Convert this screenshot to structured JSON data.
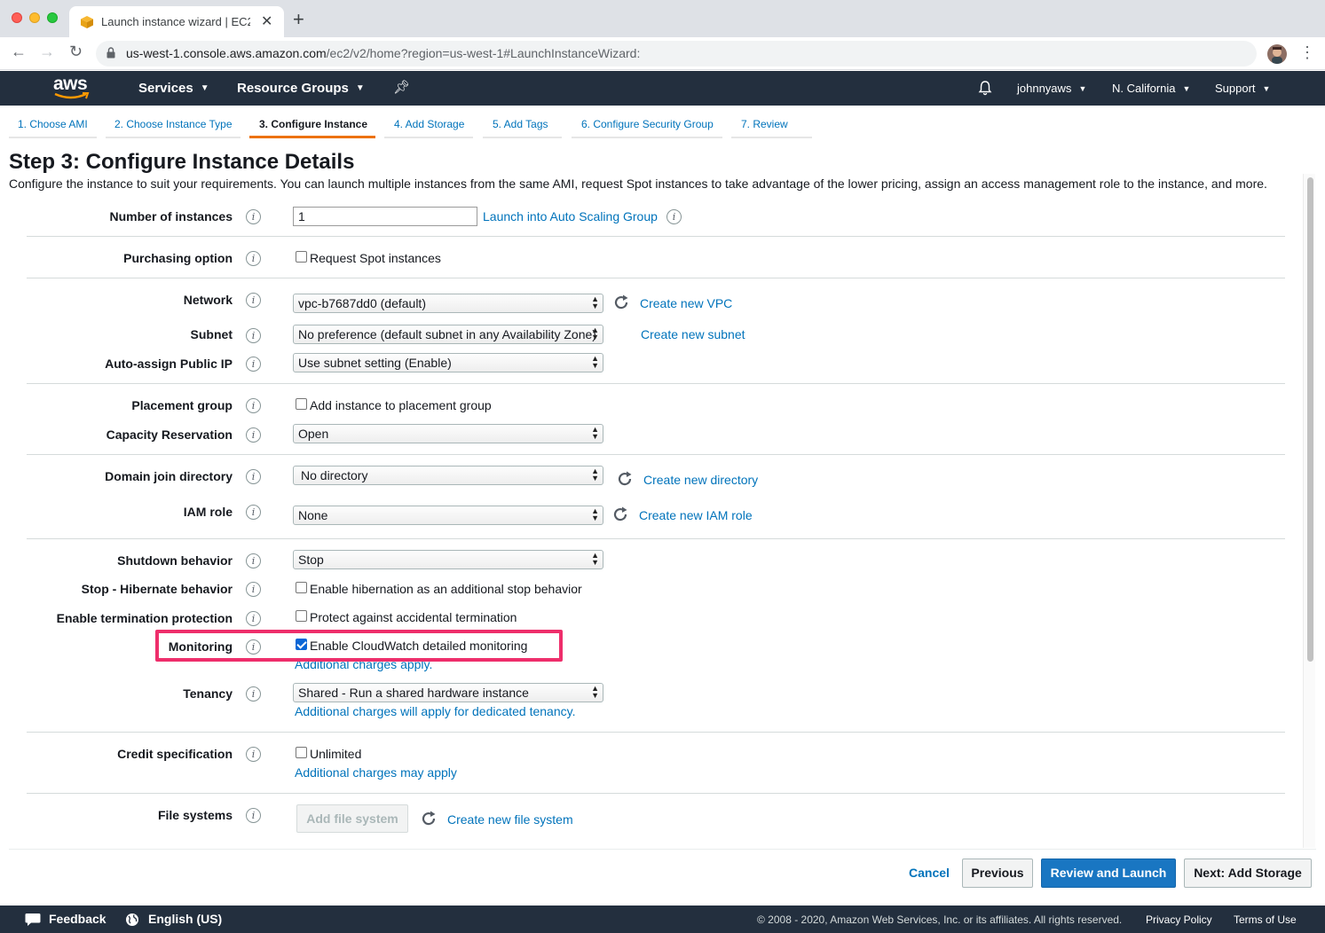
{
  "browser": {
    "tab_title": "Launch instance wizard | EC2 M",
    "url_host": "us-west-1.console.aws.amazon.com",
    "url_path": "/ec2/v2/home?region=us-west-1#LaunchInstanceWizard:"
  },
  "aws_nav": {
    "logo": "aws",
    "services": "Services",
    "resource_groups": "Resource Groups",
    "user": "johnnyaws",
    "region": "N. California",
    "support": "Support"
  },
  "wizard_tabs": [
    {
      "label": "1. Choose AMI"
    },
    {
      "label": "2. Choose Instance Type"
    },
    {
      "label": "3. Configure Instance"
    },
    {
      "label": "4. Add Storage"
    },
    {
      "label": "5. Add Tags"
    },
    {
      "label": "6. Configure Security Group"
    },
    {
      "label": "7. Review"
    }
  ],
  "page": {
    "title": "Step 3: Configure Instance Details",
    "description": "Configure the instance to suit your requirements. You can launch multiple instances from the same AMI, request Spot instances to take advantage of the lower pricing, assign an access management role to the instance, and more."
  },
  "form": {
    "number_of_instances": {
      "label": "Number of instances",
      "value": "1",
      "link": "Launch into Auto Scaling Group"
    },
    "purchasing_option": {
      "label": "Purchasing option",
      "checkbox": "Request Spot instances"
    },
    "network": {
      "label": "Network",
      "value": "vpc-b7687dd0 (default)",
      "link": "Create new VPC"
    },
    "subnet": {
      "label": "Subnet",
      "value": "No preference (default subnet in any Availability Zone)",
      "link": "Create new subnet"
    },
    "auto_assign_ip": {
      "label": "Auto-assign Public IP",
      "value": "Use subnet setting (Enable)"
    },
    "placement_group": {
      "label": "Placement group",
      "checkbox": "Add instance to placement group"
    },
    "capacity_reservation": {
      "label": "Capacity Reservation",
      "value": "Open"
    },
    "domain_join": {
      "label": "Domain join directory",
      "value": "No directory",
      "link": "Create new directory"
    },
    "iam_role": {
      "label": "IAM role",
      "value": "None",
      "link": "Create new IAM role"
    },
    "shutdown_behavior": {
      "label": "Shutdown behavior",
      "value": "Stop"
    },
    "hibernate": {
      "label": "Stop - Hibernate behavior",
      "checkbox": "Enable hibernation as an additional stop behavior"
    },
    "termination_protection": {
      "label": "Enable termination protection",
      "checkbox": "Protect against accidental termination"
    },
    "monitoring": {
      "label": "Monitoring",
      "checkbox": "Enable CloudWatch detailed monitoring",
      "checked": true,
      "note": "Additional charges apply."
    },
    "tenancy": {
      "label": "Tenancy",
      "value": "Shared - Run a shared hardware instance",
      "note": "Additional charges will apply for dedicated tenancy."
    },
    "credit_spec": {
      "label": "Credit specification",
      "checkbox": "Unlimited",
      "note": "Additional charges may apply"
    },
    "file_systems": {
      "label": "File systems",
      "button": "Add file system",
      "link": "Create new file system"
    }
  },
  "actions": {
    "cancel": "Cancel",
    "previous": "Previous",
    "review_launch": "Review and Launch",
    "next": "Next: Add Storage"
  },
  "footer": {
    "feedback": "Feedback",
    "language": "English (US)",
    "copyright": "© 2008 - 2020, Amazon Web Services, Inc. or its affiliates. All rights reserved.",
    "privacy": "Privacy Policy",
    "terms": "Terms of Use"
  },
  "colors": {
    "nav_bg": "#232f3e",
    "link": "#0073bb",
    "active_tab": "#ec7211",
    "primary_button": "#1976c2",
    "highlight": "#ee2e6b"
  }
}
